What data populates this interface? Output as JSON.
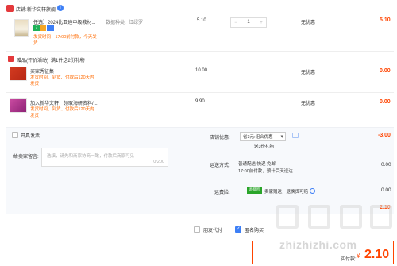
{
  "shop": {
    "badge": "店铺",
    "name": "新华文轩旗舰",
    "name_prefix": "店铺:",
    "info_icon": "info-circle-icon"
  },
  "main_item": {
    "title": "任选】2024比亚迪中级教材...",
    "spec_label": "数据种类:",
    "spec_value": "红绿罗",
    "price": "5.10",
    "qty": "1",
    "minus": "−",
    "plus": "+",
    "shipping": "无优惠",
    "subtotal": "5.10",
    "tags": [
      "7",
      "天"
    ],
    "ship_note_1": "发货时间：17:00前付款，今天发",
    "ship_note_2": "货"
  },
  "promo": {
    "label": "赠品(评价活动)",
    "condition": "满1件送2份礼物"
  },
  "gifts": [
    {
      "title": "买家秀征集",
      "note_1": "发货时间、到货、付款后120天内",
      "note_2": "发货",
      "qty": "10.00",
      "shipping": "无优惠",
      "subtotal": "0.00"
    },
    {
      "title": "加入新华文轩，领取海研资料/...",
      "note_1": "发货时间、到货、付款后120天内",
      "note_2": "发货",
      "qty": "9.90",
      "shipping": "无优惠",
      "subtotal": "0.00"
    }
  ],
  "invoice": {
    "label": "开具发票"
  },
  "message": {
    "label": "给卖家留言:",
    "placeholder": "选填，请先和商家协商一致，付款后商家可见",
    "counter": "0/200"
  },
  "shop_discount": {
    "label": "店铺优惠:",
    "selected": "省3元:组合优惠",
    "sub": "送3份礼物",
    "amount": "-3.00"
  },
  "delivery": {
    "label": "运送方式:",
    "method": "普通配送 快递 免邮",
    "note": "17:00前付款，预计后天送达",
    "amount": "0.00"
  },
  "insurance": {
    "label": "运费险:",
    "badge": "运费险",
    "desc": "卖家赠送，退换货可赔",
    "amount": "0.00"
  },
  "store_total": {
    "amount": "2.10"
  },
  "footer_options": {
    "anonymous_pay": "朋友代付",
    "anonymous_buy": "匿名购买"
  },
  "pay_total": {
    "label": "实付款:",
    "currency": "¥",
    "amount": "2.10"
  },
  "watermark": {
    "text": "zhizhizhi.com",
    "logo_chars": "值"
  },
  "colors": {
    "price_red": "#f40",
    "accent_blue": "#3d7ff6",
    "insurance_green": "#2aa52a"
  }
}
